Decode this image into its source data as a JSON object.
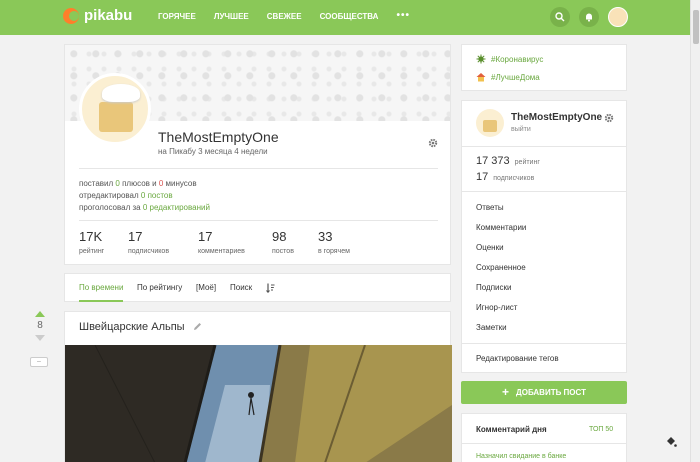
{
  "header": {
    "logo": "pikabu",
    "nav": [
      "ГОРЯЧЕЕ",
      "ЛУЧШЕЕ",
      "СВЕЖЕЕ",
      "СООБЩЕСТВА"
    ],
    "more": "•••"
  },
  "profile": {
    "nickname": "TheMostEmptyOne",
    "since": "на Пикабу 3 месяца 4 недели",
    "activity": {
      "line1_a": "поставил ",
      "plus": "0",
      "line1_b": " плюсов и ",
      "minus": "0",
      "line1_c": " минусов",
      "line2_a": "отредактировал ",
      "posts_edited": "0 постов",
      "line3_a": "проголосовал за ",
      "edits_voted": "0 редактирований"
    },
    "stats": [
      {
        "value": "17K",
        "label": "рейтинг"
      },
      {
        "value": "17",
        "label": "подписчиков"
      },
      {
        "value": "17",
        "label": "комментариев"
      },
      {
        "value": "98",
        "label": "постов"
      },
      {
        "value": "33",
        "label": "в горячем"
      }
    ]
  },
  "tabs": [
    "По времени",
    "По рейтингу",
    "[Моё]",
    "Поиск"
  ],
  "post": {
    "votes": "8",
    "collapse": "–",
    "title": "Швейцарские Альпы"
  },
  "sidebar": {
    "tags": [
      "#Коронавирус",
      "#ЛучшеДома"
    ],
    "user": {
      "name": "TheMostEmptyOne",
      "logout": "выйти",
      "rating_value": "17 373",
      "rating_label": "рейтинг",
      "subs_value": "17",
      "subs_label": "подписчиков"
    },
    "menu": [
      "Ответы",
      "Комментарии",
      "Оценки",
      "Сохраненное",
      "Подписки",
      "Игнор-лист",
      "Заметки"
    ],
    "edit_tags": "Редактирование тегов",
    "add_post": "ДОБАВИТЬ ПОСТ",
    "comment_of_day": {
      "title": "Комментарий дня",
      "top": "ТОП 50",
      "link": "Назначил свидание в банке"
    }
  },
  "colors": {
    "accent": "#8ac858",
    "link": "#6aa83f",
    "minus": "#d9534f"
  }
}
